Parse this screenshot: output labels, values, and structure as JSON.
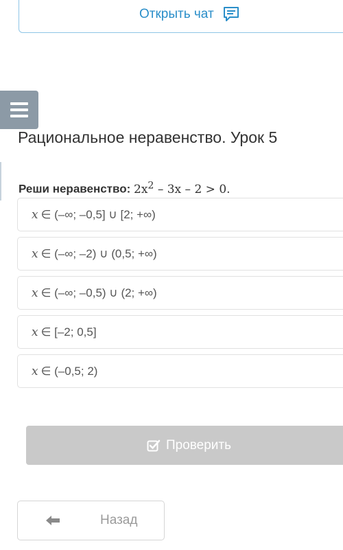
{
  "chat": {
    "label": "Открыть чат",
    "icon": "chat-icon"
  },
  "menu": {
    "icon": "hamburger-menu-icon"
  },
  "lesson": {
    "title": "Рациональное неравенство. Урок 5"
  },
  "question": {
    "prompt": "Реши неравенство:",
    "expression_prefix": "2x",
    "exponent": "2",
    "expression_suffix": " – 3x – 2 > 0."
  },
  "answers": [
    {
      "var": "x",
      "text": "∈ (–∞; –0,5] ∪ [2; +∞)"
    },
    {
      "var": "x",
      "text": "∈ (–∞; –2) ∪ (0,5; +∞)"
    },
    {
      "var": "x",
      "text": "∈ (–∞; –0,5) ∪ (2; +∞)"
    },
    {
      "var": "x",
      "text": "∈ [–2; 0,5]"
    },
    {
      "var": "x",
      "text": "∈ (–0,5; 2)"
    }
  ],
  "check_button": {
    "label": "Проверить",
    "icon": "check-square-icon"
  },
  "back_button": {
    "label": "Назад",
    "icon": "arrow-left-icon"
  },
  "colors": {
    "accent": "#2a8ec9",
    "menu_bg": "#8c9aa6",
    "disabled_button": "#c9c9c9"
  }
}
